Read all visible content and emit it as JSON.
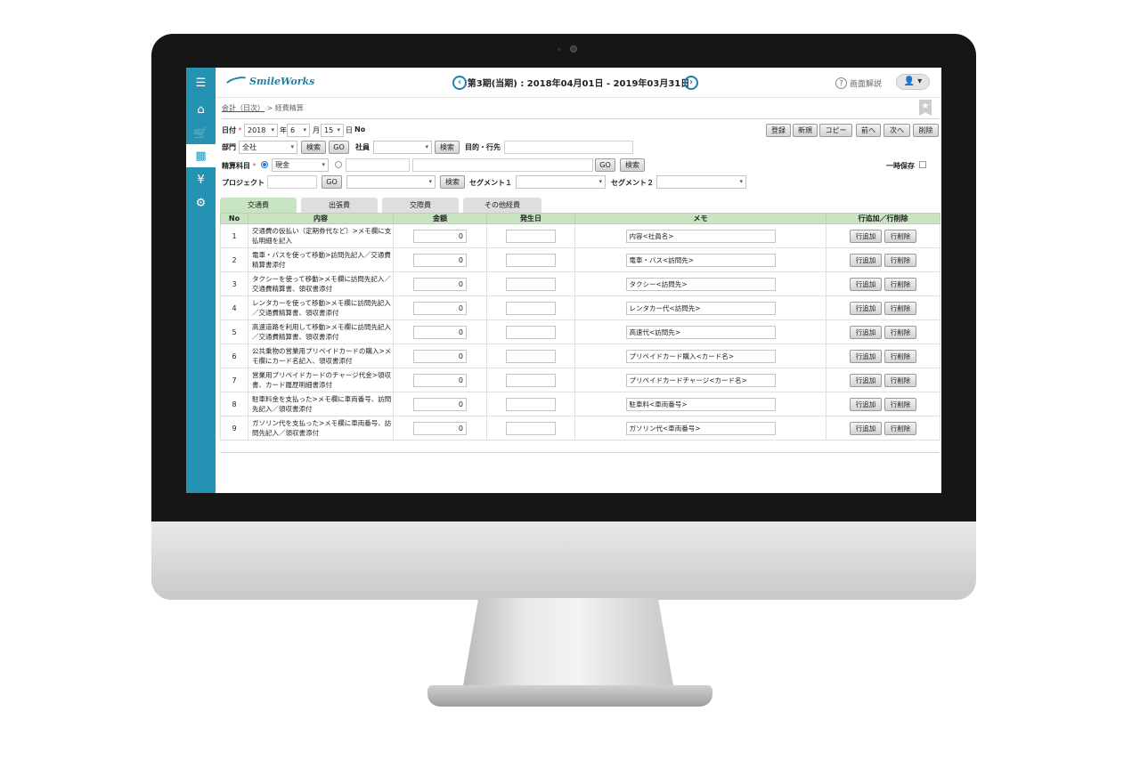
{
  "app": {
    "logo_text": "SmileWorks"
  },
  "header": {
    "period": "第3期(当期) : 2018年04月01日 - 2019年03月31日",
    "prev_icon": "chevron-left-icon",
    "next_icon": "chevron-right-icon",
    "help_label": "画面解説",
    "user_icon": "user-icon"
  },
  "sidebar": {
    "items": [
      {
        "icon": "menu-icon",
        "glyph": "☰"
      },
      {
        "icon": "home-icon",
        "glyph": "⌂"
      },
      {
        "icon": "cart-icon",
        "glyph": "🛒"
      },
      {
        "icon": "calculator-icon",
        "glyph": "▦"
      },
      {
        "icon": "money-bag-icon",
        "glyph": "¥"
      },
      {
        "icon": "gear-icon",
        "glyph": "⚙"
      }
    ]
  },
  "breadcrumb": {
    "parent": "会計（日次）",
    "separator": ">",
    "current": "経費精算"
  },
  "form": {
    "date_label": "日付",
    "year": "2018",
    "year_unit": "年",
    "month": "6",
    "month_unit": "月",
    "day": "15",
    "day_unit": "日",
    "no_label": "No",
    "dept_label": "部門",
    "dept_value": "全社",
    "search": "検索",
    "go": "GO",
    "employee_label": "社員",
    "purpose_label": "目的・行先",
    "account_label": "精算科目",
    "account_value": "現金",
    "temp_save_label": "一時保存",
    "project_label": "プロジェクト",
    "segment1_label": "セグメント１",
    "segment2_label": "セグメント２"
  },
  "toolbar": {
    "register": "登録",
    "new": "新規",
    "copy": "コピー",
    "prev": "前へ",
    "next": "次へ",
    "delete": "削除"
  },
  "tabs": [
    {
      "label": "交通費",
      "active": true
    },
    {
      "label": "出張費",
      "active": false
    },
    {
      "label": "交際費",
      "active": false
    },
    {
      "label": "その他経費",
      "active": false
    }
  ],
  "table": {
    "headers": [
      "No",
      "内容",
      "金額",
      "発生日",
      "メモ",
      "行追加／行削除"
    ],
    "add_label": "行追加",
    "delete_label": "行削除",
    "rows": [
      {
        "no": "1",
        "desc": "交通費の仮払い（定期券代など）>メモ欄に支払明細を記入",
        "amount": "0",
        "memo": "内容<社員名>"
      },
      {
        "no": "2",
        "desc": "電車・バスを使って移動>訪問先記入／交通費精算書添付",
        "amount": "0",
        "memo": "電車・バス<訪問先>"
      },
      {
        "no": "3",
        "desc": "タクシーを使って移動>メモ欄に訪問先記入／交通費精算書、領収書添付",
        "amount": "0",
        "memo": "タクシー<訪問先>"
      },
      {
        "no": "4",
        "desc": "レンタカーを使って移動>メモ欄に訪問先記入／交通費精算書、領収書添付",
        "amount": "0",
        "memo": "レンタカー代<訪問先>"
      },
      {
        "no": "5",
        "desc": "高速道路を利用して移動>メモ欄に訪問先記入／交通費精算書、領収書添付",
        "amount": "0",
        "memo": "高速代<訪問先>"
      },
      {
        "no": "6",
        "desc": "公共乗物の営業用プリペイドカードの購入>メモ欄にカード名記入、領収書添付",
        "amount": "0",
        "memo": "プリペイドカード購入<カード名>"
      },
      {
        "no": "7",
        "desc": "営業用プリペイドカードのチャージ代金>領収書、カード履歴明細書添付",
        "amount": "0",
        "memo": "プリペイドカードチャージ<カード名>"
      },
      {
        "no": "8",
        "desc": "駐車料金を支払った>メモ欄に車両番号、訪問先記入／領収書添付",
        "amount": "0",
        "memo": "駐車料<車両番号>"
      },
      {
        "no": "9",
        "desc": "ガソリン代を支払った>メモ欄に車両番号、訪問先記入／領収書添付",
        "amount": "0",
        "memo": "ガソリン代<車両番号>"
      }
    ]
  }
}
